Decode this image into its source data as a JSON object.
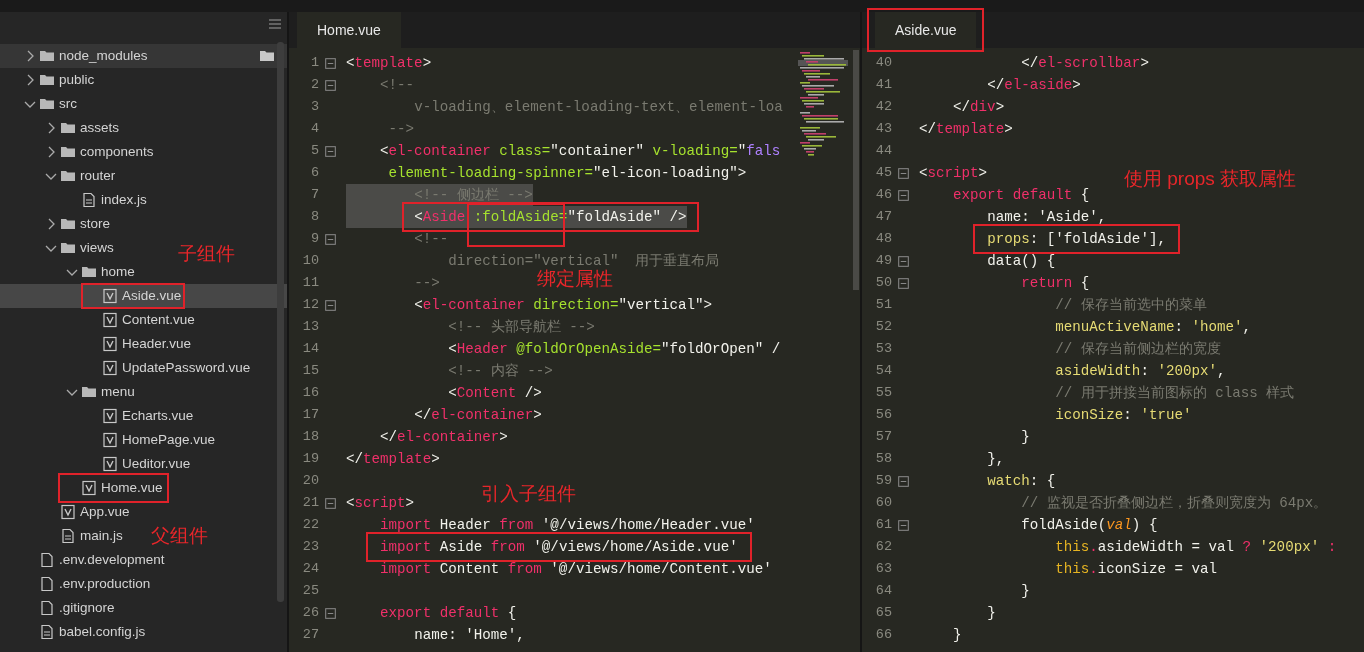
{
  "file_tree": [
    {
      "name": "node_modules",
      "kind": "folder",
      "expanded": false,
      "selected": false,
      "hovered": true
    },
    {
      "name": "public",
      "kind": "folder",
      "expanded": false,
      "selected": false,
      "hovered": false
    },
    {
      "name": "src",
      "kind": "folder",
      "expanded": true,
      "selected": false,
      "hovered": false,
      "children": [
        {
          "name": "assets",
          "kind": "folder",
          "expanded": false,
          "selected": false,
          "hovered": false
        },
        {
          "name": "components",
          "kind": "folder",
          "expanded": false,
          "selected": false,
          "hovered": false
        },
        {
          "name": "router",
          "kind": "folder",
          "expanded": true,
          "selected": false,
          "hovered": false,
          "children": [
            {
              "name": "index.js",
              "kind": "script",
              "selected": false,
              "hovered": false
            }
          ]
        },
        {
          "name": "store",
          "kind": "folder",
          "expanded": false,
          "selected": false,
          "hovered": false
        },
        {
          "name": "views",
          "kind": "folder",
          "expanded": true,
          "selected": false,
          "hovered": false,
          "children": [
            {
              "name": "home",
              "kind": "folder",
              "expanded": true,
              "selected": false,
              "hovered": false,
              "children": [
                {
                  "name": "Aside.vue",
                  "kind": "vue",
                  "selected": true,
                  "hovered": false
                },
                {
                  "name": "Content.vue",
                  "kind": "vue",
                  "selected": false,
                  "hovered": false
                },
                {
                  "name": "Header.vue",
                  "kind": "vue",
                  "selected": false,
                  "hovered": false
                },
                {
                  "name": "UpdatePassword.vue",
                  "kind": "vue",
                  "selected": false,
                  "hovered": false
                }
              ]
            },
            {
              "name": "menu",
              "kind": "folder",
              "expanded": true,
              "selected": false,
              "hovered": false,
              "children": [
                {
                  "name": "Echarts.vue",
                  "kind": "vue",
                  "selected": false,
                  "hovered": false
                },
                {
                  "name": "HomePage.vue",
                  "kind": "vue",
                  "selected": false,
                  "hovered": false
                },
                {
                  "name": "Ueditor.vue",
                  "kind": "vue",
                  "selected": false,
                  "hovered": false
                }
              ]
            },
            {
              "name": "Home.vue",
              "kind": "vue",
              "selected": false,
              "hovered": false
            }
          ]
        },
        {
          "name": "App.vue",
          "kind": "vue",
          "selected": false,
          "hovered": false
        },
        {
          "name": "main.js",
          "kind": "script",
          "selected": false,
          "hovered": false
        }
      ]
    },
    {
      "name": ".env.development",
      "kind": "file",
      "selected": false,
      "hovered": false
    },
    {
      "name": ".env.production",
      "kind": "file",
      "selected": false,
      "hovered": false
    },
    {
      "name": ".gitignore",
      "kind": "file",
      "selected": false,
      "hovered": false
    },
    {
      "name": "babel.config.js",
      "kind": "script",
      "selected": false,
      "hovered": false
    }
  ],
  "editors": [
    {
      "tab": "Home.vue",
      "minimap": true,
      "lines": [
        {
          "number": "1",
          "fold": true,
          "selected": false,
          "segments": [
            {
              "kind": "punct",
              "text": "<"
            },
            {
              "kind": "tag",
              "text": "template"
            },
            {
              "kind": "punct",
              "text": ">"
            }
          ]
        },
        {
          "number": "2",
          "fold": true,
          "selected": false,
          "segments": [
            {
              "kind": "comment",
              "text": "    <!--"
            }
          ]
        },
        {
          "number": "3",
          "fold": false,
          "selected": false,
          "segments": [
            {
              "kind": "comment",
              "text": "        v-loading、element-loading-text、element-loa"
            }
          ]
        },
        {
          "number": "4",
          "fold": false,
          "selected": false,
          "segments": [
            {
              "kind": "comment",
              "text": "     -->"
            }
          ]
        },
        {
          "number": "5",
          "fold": true,
          "selected": false,
          "segments": [
            {
              "kind": "punct",
              "text": "    <"
            },
            {
              "kind": "tag",
              "text": "el-container"
            },
            {
              "kind": "attr",
              "text": " class="
            },
            {
              "kind": "value",
              "text": "\"container\""
            },
            {
              "kind": "attr",
              "text": " v-loading="
            },
            {
              "kind": "value",
              "text": "\""
            },
            {
              "kind": "constant",
              "text": "fals"
            }
          ]
        },
        {
          "number": "6",
          "fold": false,
          "selected": false,
          "segments": [
            {
              "kind": "attr",
              "text": "     element-loading-spinner="
            },
            {
              "kind": "value",
              "text": "\"el-icon-loading\""
            },
            {
              "kind": "punct",
              "text": ">"
            }
          ]
        },
        {
          "number": "7",
          "fold": false,
          "selected": true,
          "segments": [
            {
              "kind": "comment",
              "text": "        <!-- 侧边栏 -->"
            }
          ]
        },
        {
          "number": "8",
          "fold": false,
          "selected": true,
          "segments": [
            {
              "kind": "punct",
              "text": "        <"
            },
            {
              "kind": "tag",
              "text": "Aside"
            },
            {
              "kind": "attr",
              "text": " :foldAside="
            },
            {
              "kind": "value",
              "text": "\"foldAside\""
            },
            {
              "kind": "punct",
              "text": " />"
            }
          ]
        },
        {
          "number": "9",
          "fold": true,
          "selected": false,
          "segments": [
            {
              "kind": "comment",
              "text": "        <!--"
            }
          ]
        },
        {
          "number": "10",
          "fold": false,
          "selected": false,
          "segments": [
            {
              "kind": "comment",
              "text": "            direction=\"vertical\"  用于垂直布局"
            }
          ]
        },
        {
          "number": "11",
          "fold": false,
          "selected": false,
          "segments": [
            {
              "kind": "comment",
              "text": "        -->"
            }
          ]
        },
        {
          "number": "12",
          "fold": true,
          "selected": false,
          "segments": [
            {
              "kind": "punct",
              "text": "        <"
            },
            {
              "kind": "tag",
              "text": "el-container"
            },
            {
              "kind": "attr",
              "text": " direction="
            },
            {
              "kind": "value",
              "text": "\"vertical\""
            },
            {
              "kind": "punct",
              "text": ">"
            }
          ]
        },
        {
          "number": "13",
          "fold": false,
          "selected": false,
          "segments": [
            {
              "kind": "comment",
              "text": "            <!-- 头部导航栏 -->"
            }
          ]
        },
        {
          "number": "14",
          "fold": false,
          "selected": false,
          "segments": [
            {
              "kind": "punct",
              "text": "            <"
            },
            {
              "kind": "tag",
              "text": "Header"
            },
            {
              "kind": "attr",
              "text": " @foldOrOpenAside="
            },
            {
              "kind": "value",
              "text": "\"foldOrOpen\""
            },
            {
              "kind": "punct",
              "text": " /"
            }
          ]
        },
        {
          "number": "15",
          "fold": false,
          "selected": false,
          "segments": [
            {
              "kind": "comment",
              "text": "            <!-- 内容 -->"
            }
          ]
        },
        {
          "number": "16",
          "fold": false,
          "selected": false,
          "segments": [
            {
              "kind": "punct",
              "text": "            <"
            },
            {
              "kind": "tag",
              "text": "Content"
            },
            {
              "kind": "punct",
              "text": " />"
            }
          ]
        },
        {
          "number": "17",
          "fold": false,
          "selected": false,
          "segments": [
            {
              "kind": "punct",
              "text": "        </"
            },
            {
              "kind": "tag",
              "text": "el-container"
            },
            {
              "kind": "punct",
              "text": ">"
            }
          ]
        },
        {
          "number": "18",
          "fold": false,
          "selected": false,
          "segments": [
            {
              "kind": "punct",
              "text": "    </"
            },
            {
              "kind": "tag",
              "text": "el-container"
            },
            {
              "kind": "punct",
              "text": ">"
            }
          ]
        },
        {
          "number": "19",
          "fold": false,
          "selected": false,
          "segments": [
            {
              "kind": "punct",
              "text": "</"
            },
            {
              "kind": "tag",
              "text": "template"
            },
            {
              "kind": "punct",
              "text": ">"
            }
          ]
        },
        {
          "number": "20",
          "fold": false,
          "selected": false
        },
        {
          "number": "21",
          "fold": true,
          "selected": false,
          "segments": [
            {
              "kind": "punct",
              "text": "<"
            },
            {
              "kind": "tag",
              "text": "script"
            },
            {
              "kind": "punct",
              "text": ">"
            }
          ]
        },
        {
          "number": "22",
          "fold": false,
          "selected": false,
          "segments": [
            {
              "kind": "keyword",
              "text": "    import"
            },
            {
              "kind": "plain",
              "text": " Header "
            },
            {
              "kind": "keyword",
              "text": "from"
            },
            {
              "kind": "plain",
              "text": " '@/views/home/Header.vue'"
            }
          ]
        },
        {
          "number": "23",
          "fold": false,
          "selected": false,
          "segments": [
            {
              "kind": "keyword",
              "text": "    import"
            },
            {
              "kind": "plain",
              "text": " Aside "
            },
            {
              "kind": "keyword",
              "text": "from"
            },
            {
              "kind": "plain",
              "text": " '@/views/home/Aside.vue'"
            }
          ]
        },
        {
          "number": "24",
          "fold": false,
          "selected": false,
          "segments": [
            {
              "kind": "keyword",
              "text": "    import"
            },
            {
              "kind": "plain",
              "text": " Content "
            },
            {
              "kind": "keyword",
              "text": "from"
            },
            {
              "kind": "plain",
              "text": " '@/views/home/Content.vue'"
            }
          ]
        },
        {
          "number": "25",
          "fold": false,
          "selected": false
        },
        {
          "number": "26",
          "fold": true,
          "selected": false,
          "segments": [
            {
              "kind": "keyword",
              "text": "    export default"
            },
            {
              "kind": "plain",
              "text": " {"
            }
          ]
        },
        {
          "number": "27",
          "fold": false,
          "selected": false,
          "segments": [
            {
              "kind": "plain",
              "text": "        name: 'Home',"
            }
          ]
        }
      ]
    },
    {
      "tab": "Aside.vue",
      "minimap": false,
      "lines": [
        {
          "number": "40",
          "fold": false,
          "selected": false,
          "segments": [
            {
              "kind": "punct",
              "text": "            </"
            },
            {
              "kind": "tag",
              "text": "el-scrollbar"
            },
            {
              "kind": "punct",
              "text": ">"
            }
          ]
        },
        {
          "number": "41",
          "fold": false,
          "selected": false,
          "segments": [
            {
              "kind": "punct",
              "text": "        </"
            },
            {
              "kind": "tag",
              "text": "el-aside"
            },
            {
              "kind": "punct",
              "text": ">"
            }
          ]
        },
        {
          "number": "42",
          "fold": false,
          "selected": false,
          "segments": [
            {
              "kind": "punct",
              "text": "    </"
            },
            {
              "kind": "tag",
              "text": "div"
            },
            {
              "kind": "punct",
              "text": ">"
            }
          ]
        },
        {
          "number": "43",
          "fold": false,
          "selected": false,
          "segments": [
            {
              "kind": "punct",
              "text": "</"
            },
            {
              "kind": "tag",
              "text": "template"
            },
            {
              "kind": "punct",
              "text": ">"
            }
          ]
        },
        {
          "number": "44",
          "fold": false,
          "selected": false
        },
        {
          "number": "45",
          "fold": true,
          "selected": false,
          "segments": [
            {
              "kind": "punct",
              "text": "<"
            },
            {
              "kind": "tag",
              "text": "script"
            },
            {
              "kind": "punct",
              "text": ">"
            }
          ]
        },
        {
          "number": "46",
          "fold": true,
          "selected": false,
          "segments": [
            {
              "kind": "keyword",
              "text": "    export default"
            },
            {
              "kind": "plain",
              "text": " {"
            }
          ]
        },
        {
          "number": "47",
          "fold": false,
          "selected": false,
          "segments": [
            {
              "kind": "plain",
              "text": "        name: 'Aside',"
            }
          ]
        },
        {
          "number": "48",
          "fold": false,
          "selected": false,
          "segments": [
            {
              "kind": "property",
              "text": "        props"
            },
            {
              "kind": "plain",
              "text": ": ['foldAside'],"
            }
          ]
        },
        {
          "number": "49",
          "fold": true,
          "selected": false,
          "segments": [
            {
              "kind": "plain",
              "text": "        data() {"
            }
          ]
        },
        {
          "number": "50",
          "fold": true,
          "selected": false,
          "segments": [
            {
              "kind": "keyword",
              "text": "            return"
            },
            {
              "kind": "plain",
              "text": " {"
            }
          ]
        },
        {
          "number": "51",
          "fold": false,
          "selected": false,
          "segments": [
            {
              "kind": "comment",
              "text": "                // 保存当前选中的菜单"
            }
          ]
        },
        {
          "number": "52",
          "fold": false,
          "selected": false,
          "segments": [
            {
              "kind": "property",
              "text": "                menuActiveName"
            },
            {
              "kind": "plain",
              "text": ": "
            },
            {
              "kind": "string",
              "text": "'home'"
            },
            {
              "kind": "plain",
              "text": ","
            }
          ]
        },
        {
          "number": "53",
          "fold": false,
          "selected": false,
          "segments": [
            {
              "kind": "comment",
              "text": "                // 保存当前侧边栏的宽度"
            }
          ]
        },
        {
          "number": "54",
          "fold": false,
          "selected": false,
          "segments": [
            {
              "kind": "property",
              "text": "                asideWidth"
            },
            {
              "kind": "plain",
              "text": ": "
            },
            {
              "kind": "string",
              "text": "'200px'"
            },
            {
              "kind": "plain",
              "text": ","
            }
          ]
        },
        {
          "number": "55",
          "fold": false,
          "selected": false,
          "segments": [
            {
              "kind": "comment",
              "text": "                // 用于拼接当前图标的 class 样式"
            }
          ]
        },
        {
          "number": "56",
          "fold": false,
          "selected": false,
          "segments": [
            {
              "kind": "property",
              "text": "                iconSize"
            },
            {
              "kind": "plain",
              "text": ": "
            },
            {
              "kind": "string",
              "text": "'true'"
            }
          ]
        },
        {
          "number": "57",
          "fold": false,
          "selected": false,
          "segments": [
            {
              "kind": "plain",
              "text": "            }"
            }
          ]
        },
        {
          "number": "58",
          "fold": false,
          "selected": false,
          "segments": [
            {
              "kind": "plain",
              "text": "        },"
            }
          ]
        },
        {
          "number": "59",
          "fold": true,
          "selected": false,
          "segments": [
            {
              "kind": "property",
              "text": "        watch"
            },
            {
              "kind": "plain",
              "text": ": {"
            }
          ]
        },
        {
          "number": "60",
          "fold": false,
          "selected": false,
          "segments": [
            {
              "kind": "comment",
              "text": "            // 监视是否折叠侧边栏，折叠则宽度为 64px。"
            }
          ]
        },
        {
          "number": "61",
          "fold": true,
          "selected": false,
          "segments": [
            {
              "kind": "plain",
              "text": "            foldAside("
            },
            {
              "kind": "param",
              "text": "val"
            },
            {
              "kind": "plain",
              "text": ") {"
            }
          ]
        },
        {
          "number": "62",
          "fold": false,
          "selected": false,
          "segments": [
            {
              "kind": "self",
              "text": "                this"
            },
            {
              "kind": "keyword",
              "text": "."
            },
            {
              "kind": "plain",
              "text": "asideWidth = val "
            },
            {
              "kind": "keyword",
              "text": "?"
            },
            {
              "kind": "string",
              "text": " '200px'"
            },
            {
              "kind": "keyword",
              "text": " :"
            }
          ]
        },
        {
          "number": "63",
          "fold": false,
          "selected": false,
          "segments": [
            {
              "kind": "self",
              "text": "                this"
            },
            {
              "kind": "keyword",
              "text": "."
            },
            {
              "kind": "plain",
              "text": "iconSize = val"
            }
          ]
        },
        {
          "number": "64",
          "fold": false,
          "selected": false,
          "segments": [
            {
              "kind": "plain",
              "text": "            }"
            }
          ]
        },
        {
          "number": "65",
          "fold": false,
          "selected": false,
          "segments": [
            {
              "kind": "plain",
              "text": "        }"
            }
          ]
        },
        {
          "number": "66",
          "fold": false,
          "selected": false,
          "segments": [
            {
              "kind": "plain",
              "text": "    }"
            }
          ]
        }
      ]
    }
  ],
  "annotations": [
    {
      "text": "子组件"
    },
    {
      "text": "绑定属性"
    },
    {
      "text": "引入子组件"
    },
    {
      "text": "父组件"
    },
    {
      "text": "使用 props 获取属性"
    }
  ]
}
